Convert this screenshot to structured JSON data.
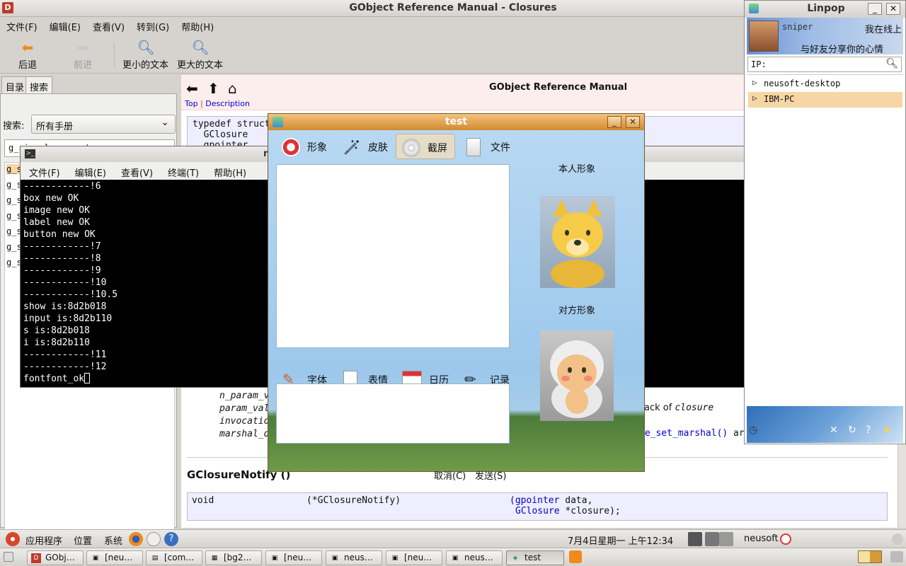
{
  "devhelp": {
    "title": "GObject Reference Manual - Closures",
    "menu": [
      "文件(F)",
      "编辑(E)",
      "查看(V)",
      "转到(G)",
      "帮助(H)"
    ],
    "toolbar": {
      "back": "后退",
      "forward": "前进",
      "smaller_text": "更小的文本",
      "larger_text": "更大的文本"
    },
    "tabs": [
      "目录",
      "搜索"
    ],
    "search_label": "搜索:",
    "search_scope": "所有手册",
    "search_value": "g_signal_connect",
    "results": [
      "g_s",
      "g_s",
      "g_s",
      "g_s",
      "g_s",
      "g_s",
      "g_s"
    ],
    "doc": {
      "manual_title": "GObject Reference Manual",
      "link_top": "Top",
      "link_sep": "|",
      "link_description": "Description",
      "struct_lines": [
        "typedef struct",
        "  GClosure",
        "  gpointer"
      ],
      "params": [
        "n_param_v",
        "param_val",
        "invocatio",
        "marshal_d"
      ],
      "param_text_1": "ack of",
      "param_text_1_em": "closure",
      "param_text_2_link": "re_set_marshal()",
      "param_text_2_tail": " ar",
      "section_title": "GClosureNotify ()",
      "sig_void": "void",
      "sig_fn": "(*GClosureNotify)",
      "sig_arg1_type": "(gpointer",
      "sig_arg1_name": " data,",
      "sig_arg2_type": "GClosure",
      "sig_arg2_name": " *closure);"
    }
  },
  "terminal": {
    "title_fragment": "n",
    "menu": [
      "文件(F)",
      "编辑(E)",
      "查看(V)",
      "终端(T)",
      "帮助(H)"
    ],
    "lines": [
      "------------!6",
      "box new OK",
      "image new OK",
      "label new OK",
      "button new OK",
      "------------!7",
      "------------!8",
      "------------!9",
      "------------!10",
      "------------!10.5",
      "show is:8d2b018",
      "input is:8d2b110",
      "s is:8d2b018",
      "i is:8d2b110",
      "------------!11",
      "------------!12"
    ],
    "prompt_line": "fontfont_ok"
  },
  "test_window": {
    "title": "test",
    "tabs": [
      "形象",
      "皮肤",
      "截屏",
      "文件"
    ],
    "selected_tab": "截屏",
    "tools": [
      "字体",
      "表情",
      "日历",
      "记录"
    ],
    "self_label": "本人形象",
    "peer_label": "对方形象",
    "cancel": "取消(C)",
    "send": "发送(S)",
    "minimize": "_",
    "close": "✕"
  },
  "linpop": {
    "title": "Linpop",
    "username": "sniper",
    "status": "我在线上",
    "signature": "与好友分享你的心情",
    "ip_label": "IP:",
    "contacts": [
      {
        "name": "neusoft-desktop",
        "selected": false
      },
      {
        "name": "IBM-PC",
        "selected": true
      }
    ],
    "minimize": "_",
    "close": "✕"
  },
  "top_panel": {
    "menus": [
      "应用程序",
      "位置",
      "系统"
    ],
    "clock": "7月4日星期一 上午12:34",
    "user": "neusoft"
  },
  "taskbar": [
    {
      "label": "GObj…",
      "icon": "D",
      "active": false
    },
    {
      "label": "[neu…",
      "icon": "▣",
      "active": false
    },
    {
      "label": "[com…",
      "icon": "▤",
      "active": false
    },
    {
      "label": "[bg2…",
      "icon": "▦",
      "active": false
    },
    {
      "label": "[neu…",
      "icon": "▣",
      "active": false
    },
    {
      "label": "neus…",
      "icon": "▣",
      "active": false
    },
    {
      "label": "[neu…",
      "icon": "▣",
      "active": false
    },
    {
      "label": "neus…",
      "icon": "▣",
      "active": false
    },
    {
      "label": "test",
      "icon": "◈",
      "active": true
    }
  ],
  "colors": {
    "devhelp_icon": "#c0392b",
    "test_titlebar": "#e8a550",
    "linpop_selected": "#f6d6a4",
    "link": "#0000cc"
  }
}
